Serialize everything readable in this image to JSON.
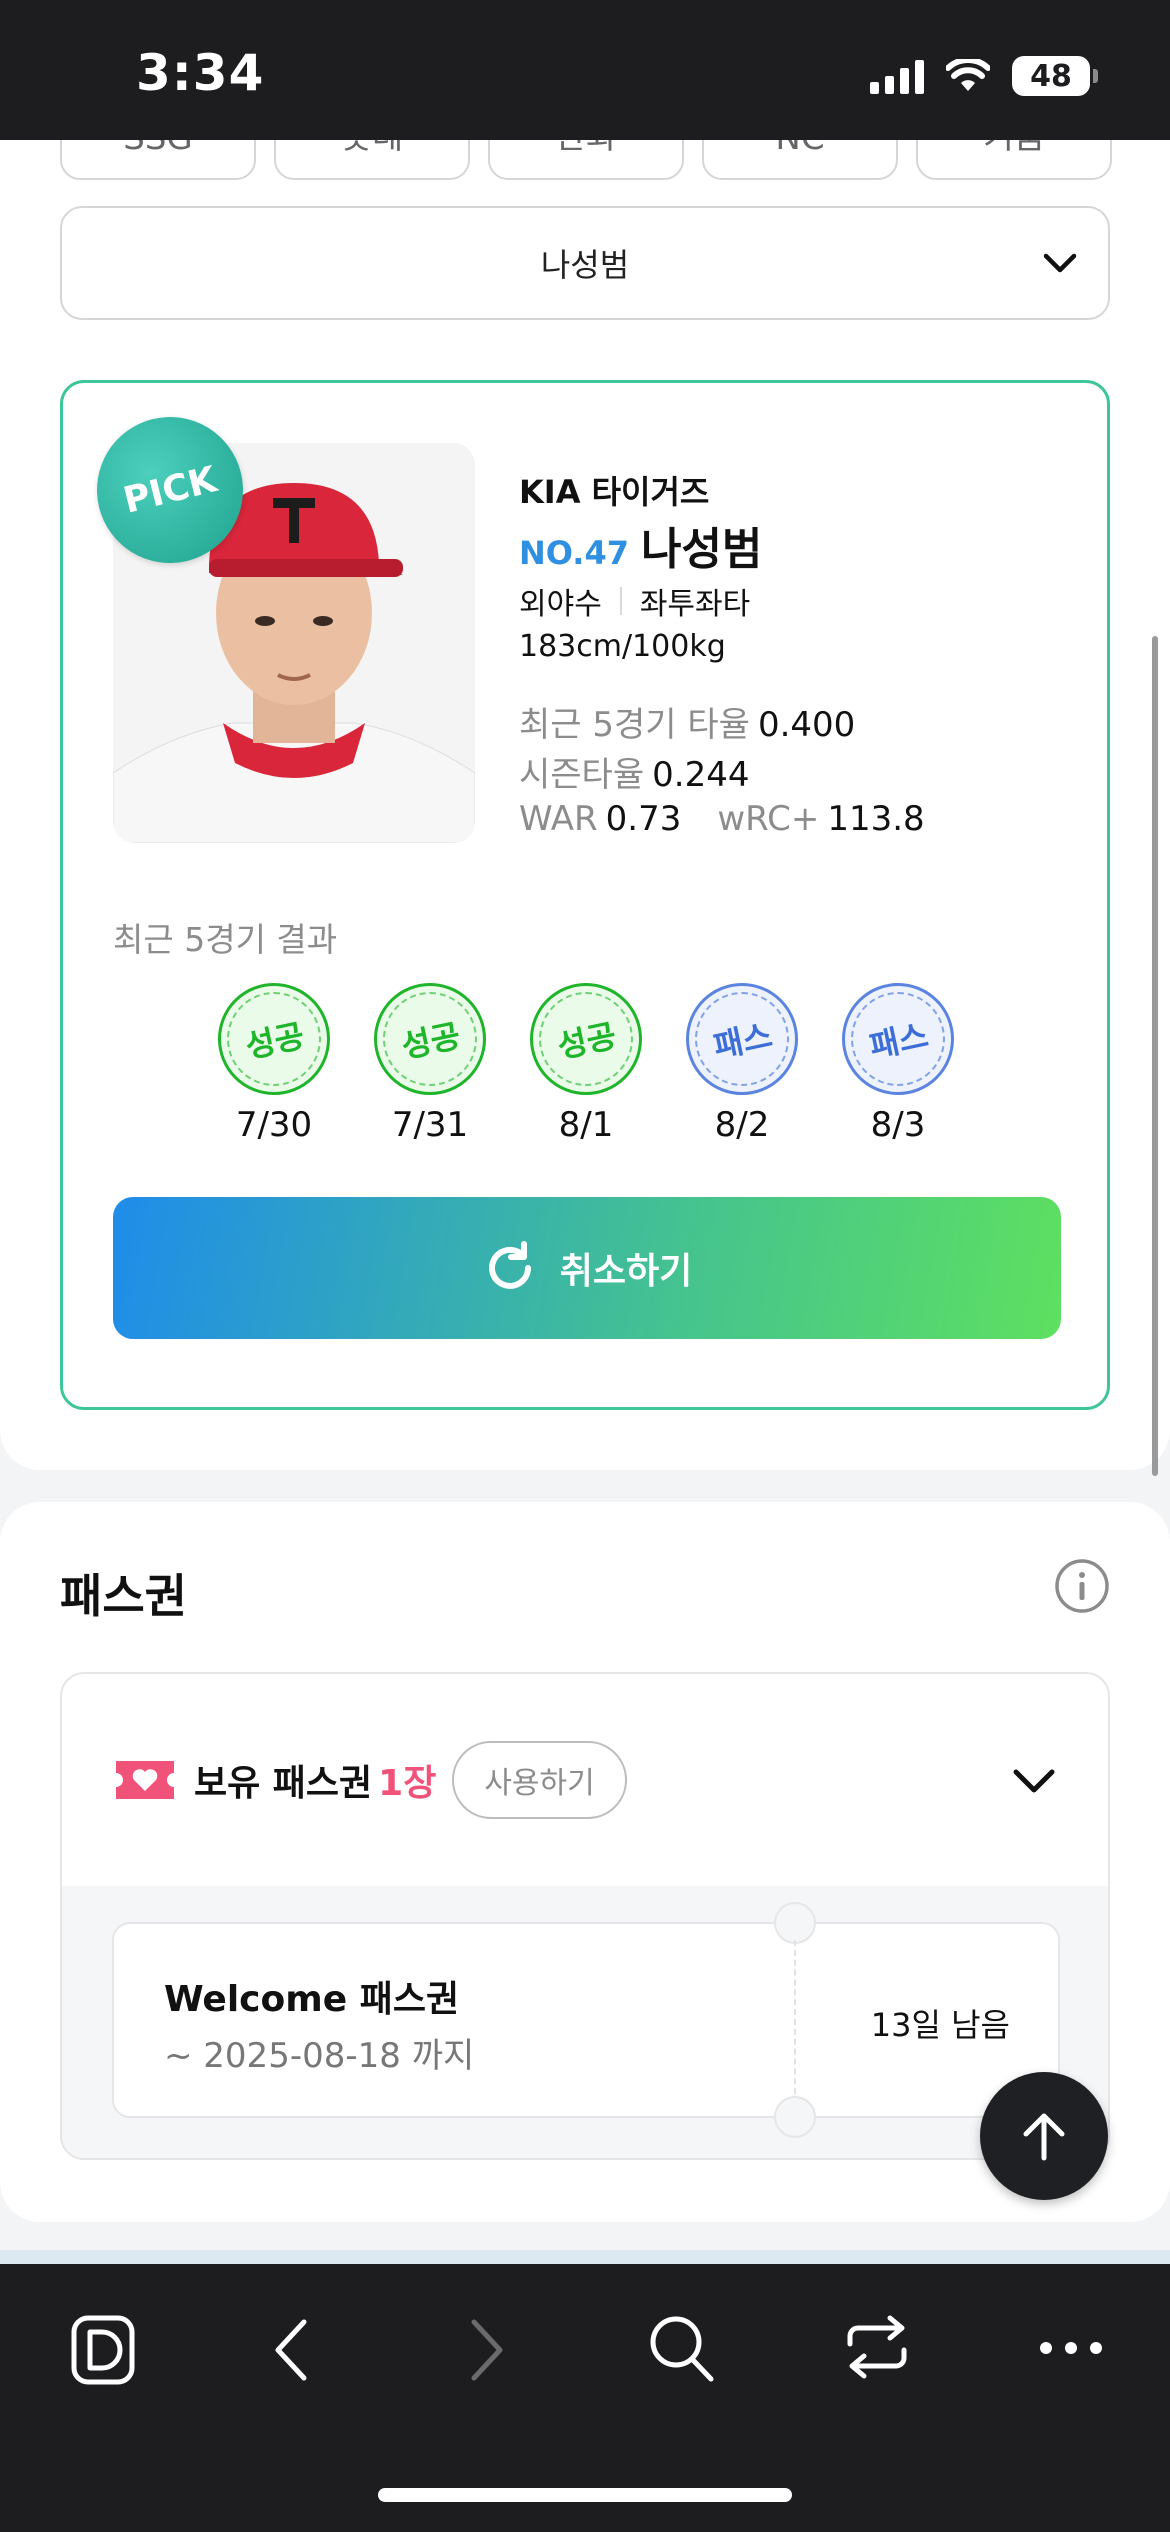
{
  "status_bar": {
    "time": "3:34",
    "battery": "48"
  },
  "team_tabs": [
    "SSG",
    "롯데",
    "한화",
    "NC",
    "키움"
  ],
  "player_select": {
    "value": "나성범"
  },
  "player": {
    "pick_label": "PICK",
    "team": "KIA 타이거즈",
    "number": "NO.47",
    "name": "나성범",
    "position": "외야수",
    "bat_throw": "좌투좌타",
    "height_weight": "183cm/100kg",
    "stats": {
      "recent5_label": "최근 5경기 타율",
      "recent5_value": "0.400",
      "season_label": "시즌타율",
      "season_value": "0.244",
      "war_label": "WAR",
      "war_value": "0.73",
      "wrc_label": "wRC+",
      "wrc_value": "113.8"
    }
  },
  "recent_results": {
    "label": "최근 5경기 결과",
    "items": [
      {
        "result": "성공",
        "type": "success",
        "date": "7/30"
      },
      {
        "result": "성공",
        "type": "success",
        "date": "7/31"
      },
      {
        "result": "성공",
        "type": "success",
        "date": "8/1"
      },
      {
        "result": "패스",
        "type": "pass",
        "date": "8/2"
      },
      {
        "result": "패스",
        "type": "pass",
        "date": "8/3"
      }
    ]
  },
  "cancel_button": {
    "label": "취소하기"
  },
  "pass_section": {
    "title": "패스권",
    "owned_label": "보유 패스권",
    "owned_count": "1장",
    "use_button": "사용하기",
    "coupon": {
      "name": "Welcome 패스권",
      "period": "~ 2025-08-18 까지",
      "remaining": "13일 남음"
    }
  },
  "colors": {
    "accent_blue": "#2f8fe0",
    "success_green": "#1fb52b",
    "pass_blue": "#3d6ed8",
    "count_pink": "#f0527a",
    "card_border": "#3ec59a"
  },
  "browser_bar": {
    "icons": [
      "app-logo-icon",
      "back-icon",
      "forward-icon",
      "search-icon",
      "tabs-icon",
      "more-icon"
    ]
  }
}
